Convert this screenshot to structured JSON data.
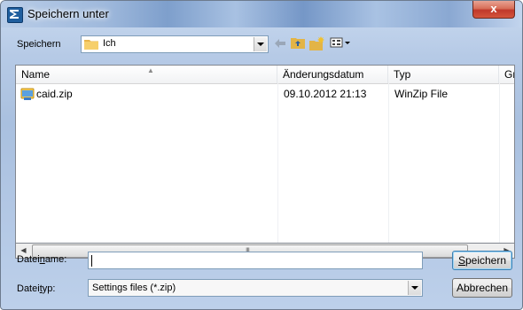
{
  "window": {
    "title": "Speichern unter",
    "close_glyph": "x"
  },
  "location": {
    "label": "Speichern",
    "folder": "Ich"
  },
  "toolbar": {
    "back_icon": "arrow-left-icon",
    "up_icon": "folder-up-icon",
    "new_folder_icon": "new-folder-icon",
    "view_icon": "view-menu-icon"
  },
  "columns": [
    "Name",
    "Änderungsdatum",
    "Typ",
    "Größ"
  ],
  "files": [
    {
      "name": "caid.zip",
      "date": "09.10.2012 21:13",
      "type": "WinZip File"
    }
  ],
  "filename": {
    "label_pre": "Datei",
    "label_u": "n",
    "label_post": "ame:",
    "value": ""
  },
  "filetype": {
    "label_pre": "Datei",
    "label_u": "t",
    "label_post": "yp:",
    "value": "Settings files (*.zip)"
  },
  "buttons": {
    "save_u": "S",
    "save_rest": "peichern",
    "cancel": "Abbrechen"
  },
  "colors": {
    "accent": "#3c7fb1",
    "close": "#c0392b"
  }
}
